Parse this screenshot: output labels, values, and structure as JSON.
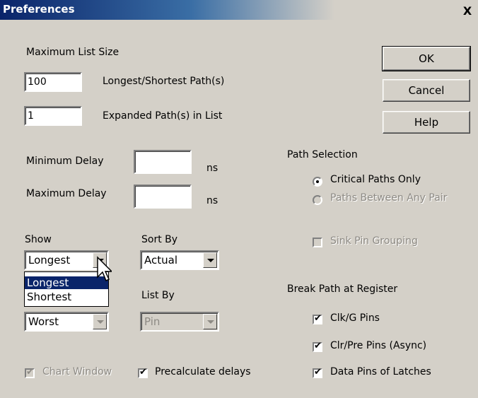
{
  "window": {
    "title": "Preferences",
    "close_glyph": "X"
  },
  "max_list": {
    "heading": "Maximum List Size",
    "longest_value": "100",
    "longest_label": "Longest/Shortest Path(s)",
    "expanded_value": "1",
    "expanded_label": "Expanded Path(s) in List"
  },
  "buttons": {
    "ok": "OK",
    "cancel": "Cancel",
    "help": "Help"
  },
  "delay": {
    "min_label": "Minimum Delay",
    "min_value": "",
    "min_unit": "ns",
    "max_label": "Maximum Delay",
    "max_value": "",
    "max_unit": "ns"
  },
  "path_selection": {
    "heading": "Path Selection",
    "critical": "Critical Paths Only",
    "between": "Paths Between Any Pair",
    "selected": "critical"
  },
  "show": {
    "label": "Show",
    "value": "Longest",
    "options": [
      "Longest",
      "Shortest"
    ],
    "highlighted": "Longest"
  },
  "sort_by": {
    "label": "Sort By",
    "value": "Actual"
  },
  "list_by": {
    "label": "List By",
    "value": "Pin"
  },
  "worst_combo": {
    "value": "Worst"
  },
  "sink_pin": {
    "label": "Sink Pin Grouping",
    "checked": false,
    "enabled": false
  },
  "break_path": {
    "heading": "Break Path at Register",
    "clk": {
      "label": "Clk/G Pins",
      "checked": true
    },
    "clr": {
      "label": "Clr/Pre Pins (Async)",
      "checked": true
    },
    "data": {
      "label": "Data Pins of Latches",
      "checked": true
    }
  },
  "chart_window": {
    "label": "Chart Window",
    "checked": true,
    "enabled": false
  },
  "precalculate": {
    "label": "Precalculate delays",
    "checked": true
  }
}
